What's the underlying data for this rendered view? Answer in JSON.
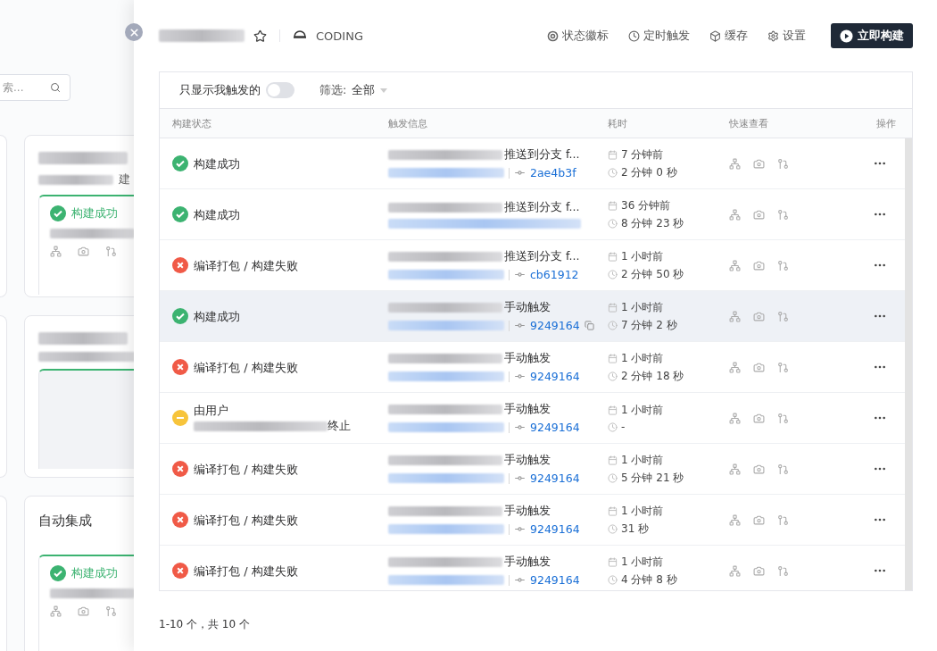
{
  "background": {
    "search": {
      "placeholder": "索..."
    },
    "cards": [
      {
        "kind": "build",
        "subtitle_tail": "建",
        "build": {
          "kind": "success",
          "label": "构建成功"
        }
      },
      {
        "kind": "empty"
      },
      {
        "kind": "build",
        "title": "自动集成",
        "build": {
          "kind": "success",
          "label": "构建成功"
        }
      }
    ]
  },
  "drawer": {
    "starred": false,
    "team": "CODING",
    "actions": [
      {
        "kind": "badge",
        "label": "状态徽标"
      },
      {
        "kind": "timer",
        "label": "定时触发"
      },
      {
        "kind": "cache",
        "label": "缓存"
      },
      {
        "kind": "settings",
        "label": "设置"
      }
    ],
    "primary_button": "立即构建"
  },
  "filter": {
    "only_mine_label": "只显示我触发的",
    "only_mine": false,
    "filter_label": "筛选:",
    "filter_value": "全部"
  },
  "table": {
    "columns": [
      "构建状态",
      "触发信息",
      "耗时",
      "快速查看",
      "操作"
    ],
    "rows": [
      {
        "kind": "success",
        "label": "构建成功",
        "trigger": "推送到分支 f...",
        "commit": "2ae4b3f",
        "time_ago": "7 分钟前",
        "duration": "2 分钟 0 秒",
        "highlighted": false
      },
      {
        "kind": "success",
        "label": "构建成功",
        "trigger": "推送到分支 f...",
        "time_ago": "36 分钟前",
        "duration": "8 分钟 23 秒",
        "highlighted": false
      },
      {
        "kind": "failed",
        "label": "编译打包 / 构建失败",
        "trigger": "推送到分支 f...",
        "commit": "cb61912",
        "time_ago": "1 小时前",
        "duration": "2 分钟 50 秒",
        "highlighted": false
      },
      {
        "kind": "success",
        "label": "构建成功",
        "trigger": "手动触发",
        "commit": "9249164",
        "time_ago": "1 小时前",
        "duration": "7 分钟 2 秒",
        "highlighted": true
      },
      {
        "kind": "failed",
        "label": "编译打包 / 构建失败",
        "trigger": "手动触发",
        "commit": "9249164",
        "time_ago": "1 小时前",
        "duration": "2 分钟 18 秒",
        "highlighted": false
      },
      {
        "kind": "stopped",
        "label": "由用户",
        "label_tail": "终止",
        "trigger": "手动触发",
        "commit": "9249164",
        "time_ago": "1 小时前",
        "duration": "-",
        "highlighted": false
      },
      {
        "kind": "failed",
        "label": "编译打包 / 构建失败",
        "trigger": "手动触发",
        "commit": "9249164",
        "time_ago": "1 小时前",
        "duration": "5 分钟 21 秒",
        "highlighted": false
      },
      {
        "kind": "failed",
        "label": "编译打包 / 构建失败",
        "trigger": "手动触发",
        "commit": "9249164",
        "time_ago": "1 小时前",
        "duration": "31 秒",
        "highlighted": false
      },
      {
        "kind": "failed",
        "label": "编译打包 / 构建失败",
        "trigger": "手动触发",
        "commit": "9249164",
        "time_ago": "1 小时前",
        "duration": "4 分钟 8 秒",
        "highlighted": false
      }
    ]
  },
  "pagination": {
    "summary": "1-10 个，共 10 个"
  }
}
